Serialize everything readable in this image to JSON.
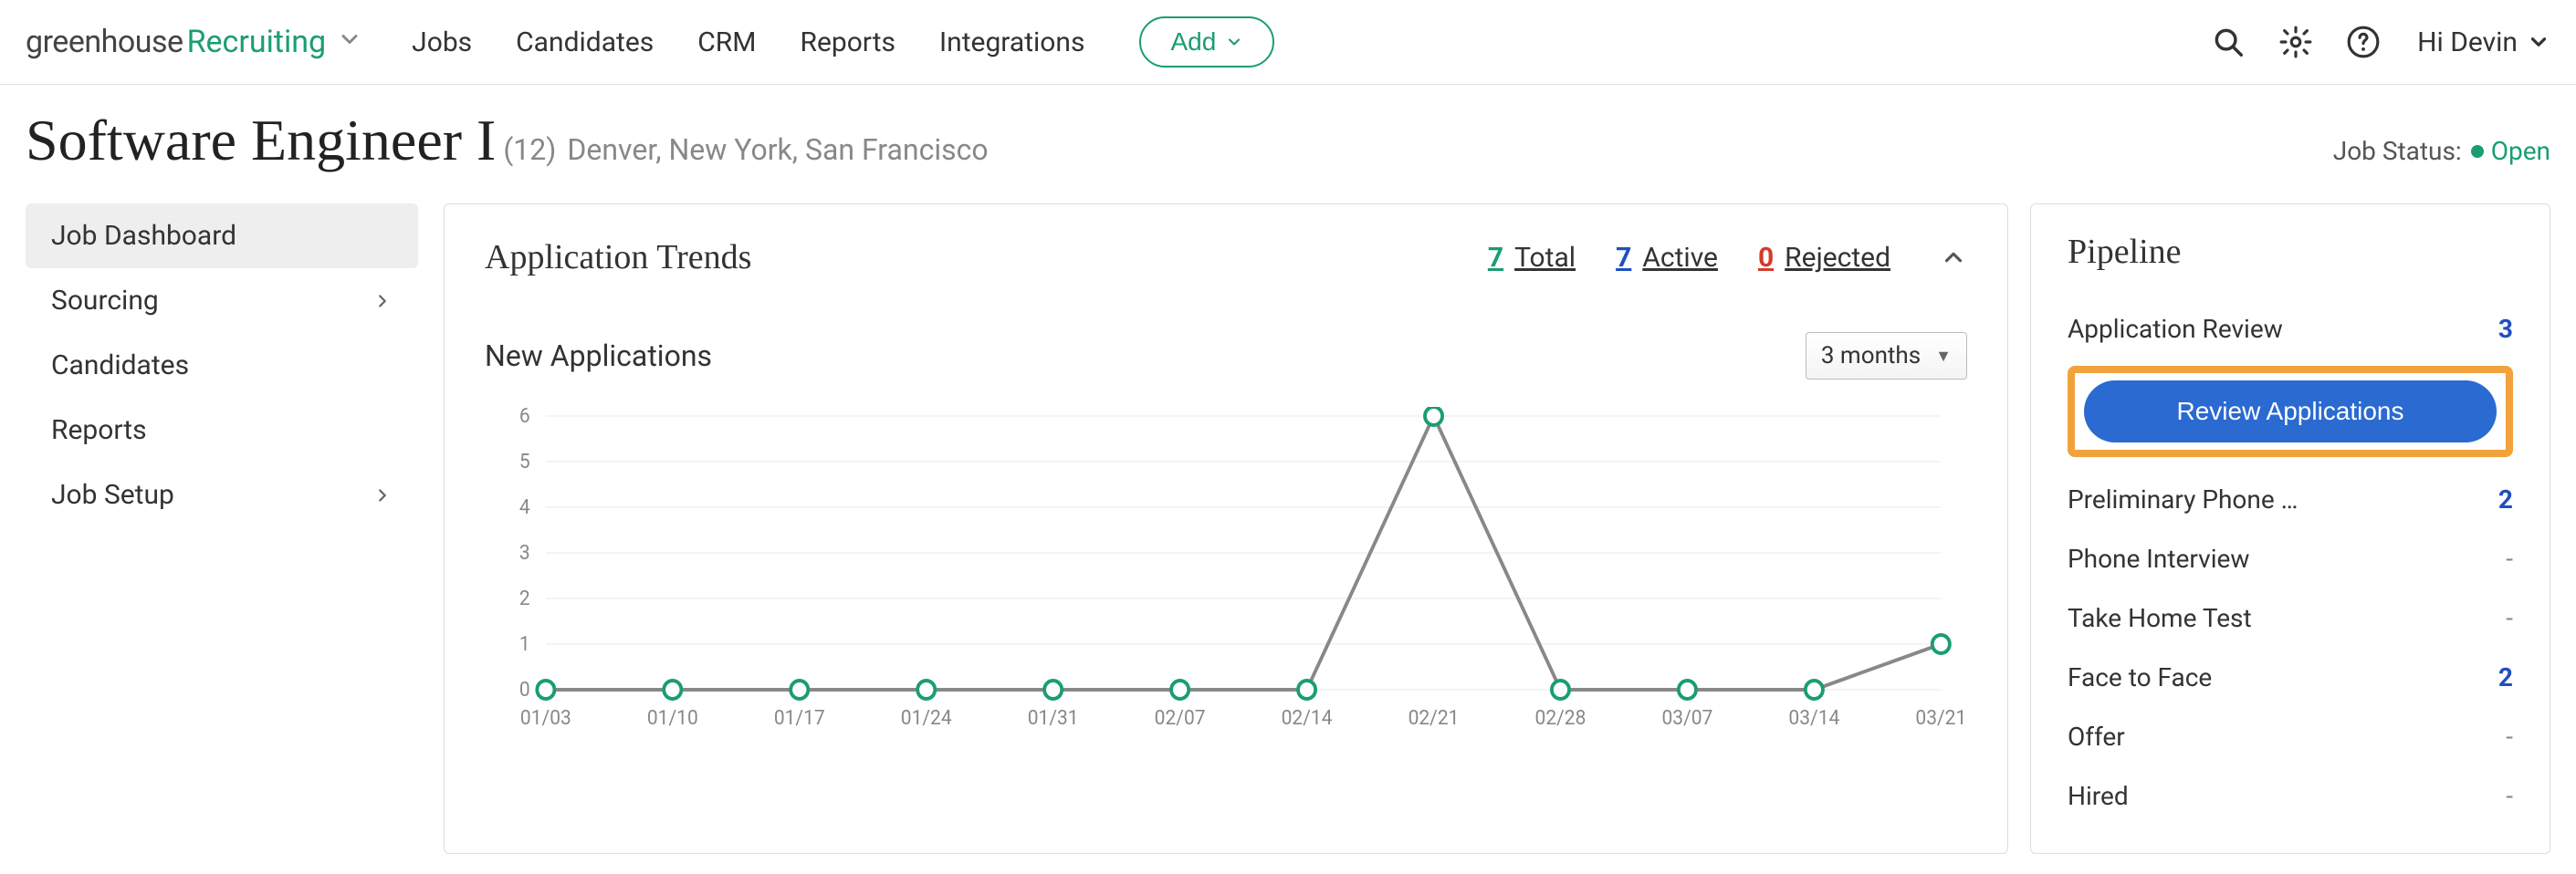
{
  "nav": {
    "logo_greenhouse": "greenhouse",
    "logo_recruiting": "Recruiting",
    "links": [
      "Jobs",
      "Candidates",
      "CRM",
      "Reports",
      "Integrations"
    ],
    "add_label": "Add",
    "user_greeting": "Hi Devin"
  },
  "job": {
    "title": "Software Engineer I",
    "count": "(12)",
    "locations": "Denver, New York, San Francisco",
    "status_label": "Job Status:",
    "status_value": "Open"
  },
  "sidebar": {
    "items": [
      {
        "label": "Job Dashboard",
        "has_chevron": false,
        "active": true
      },
      {
        "label": "Sourcing",
        "has_chevron": true,
        "active": false
      },
      {
        "label": "Candidates",
        "has_chevron": false,
        "active": false
      },
      {
        "label": "Reports",
        "has_chevron": false,
        "active": false
      },
      {
        "label": "Job Setup",
        "has_chevron": true,
        "active": false
      }
    ]
  },
  "trends": {
    "title": "Application Trends",
    "stats": {
      "total": {
        "num": "7",
        "label": "Total"
      },
      "active": {
        "num": "7",
        "label": "Active"
      },
      "rejected": {
        "num": "0",
        "label": "Rejected"
      }
    },
    "new_apps_title": "New Applications",
    "timeframe": "3 months"
  },
  "pipeline": {
    "title": "Pipeline",
    "review_button": "Review Applications",
    "stages": [
      {
        "label": "Application Review",
        "count": "3"
      },
      {
        "label": "Preliminary Phone …",
        "count": "2"
      },
      {
        "label": "Phone Interview",
        "count": "-"
      },
      {
        "label": "Take Home Test",
        "count": "-"
      },
      {
        "label": "Face to Face",
        "count": "2"
      },
      {
        "label": "Offer",
        "count": "-"
      },
      {
        "label": "Hired",
        "count": "-"
      }
    ]
  },
  "chart_data": {
    "type": "line",
    "title": "New Applications",
    "xlabel": "",
    "ylabel": "",
    "ylim": [
      0,
      6
    ],
    "categories": [
      "01/03",
      "01/10",
      "01/17",
      "01/24",
      "01/31",
      "02/07",
      "02/14",
      "02/21",
      "02/28",
      "03/07",
      "03/14",
      "03/21"
    ],
    "values": [
      0,
      0,
      0,
      0,
      0,
      0,
      0,
      6,
      0,
      0,
      0,
      1
    ]
  }
}
